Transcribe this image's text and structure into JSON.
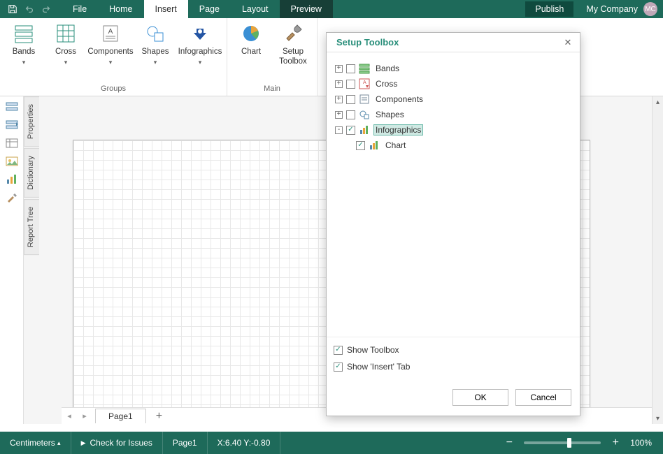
{
  "topbar": {
    "menus": [
      "File",
      "Home",
      "Insert",
      "Page",
      "Layout",
      "Preview"
    ],
    "active_menu": "Insert",
    "publish": "Publish",
    "company": "My Company",
    "avatar": "MC"
  },
  "ribbon": {
    "groups": [
      {
        "label": "Groups",
        "items": [
          {
            "key": "bands",
            "label": "Bands",
            "dropdown": true
          },
          {
            "key": "cross",
            "label": "Cross",
            "dropdown": true
          },
          {
            "key": "components",
            "label": "Components",
            "dropdown": true
          },
          {
            "key": "shapes",
            "label": "Shapes",
            "dropdown": true
          },
          {
            "key": "infographics",
            "label": "Infographics",
            "dropdown": true
          }
        ]
      },
      {
        "label": "Main",
        "items": [
          {
            "key": "chart",
            "label": "Chart",
            "dropdown": false
          },
          {
            "key": "setup-toolbox",
            "label": "Setup\nToolbox",
            "dropdown": false
          }
        ]
      }
    ]
  },
  "side_tabs": [
    "Properties",
    "Dictionary",
    "Report Tree"
  ],
  "page_tabs": {
    "page": "Page1"
  },
  "dialog": {
    "title": "Setup Toolbox",
    "tree": [
      {
        "exp": "+",
        "checked": false,
        "icon": "bands",
        "label": "Bands"
      },
      {
        "exp": "+",
        "checked": false,
        "icon": "cross",
        "label": "Cross"
      },
      {
        "exp": "+",
        "checked": false,
        "icon": "components",
        "label": "Components"
      },
      {
        "exp": "+",
        "checked": false,
        "icon": "shapes",
        "label": "Shapes"
      },
      {
        "exp": "-",
        "checked": true,
        "icon": "infographics",
        "label": "Infographics",
        "selected": true
      },
      {
        "indent": true,
        "checked": true,
        "icon": "chart",
        "label": "Chart"
      }
    ],
    "opt1": "Show Toolbox",
    "opt2": "Show 'Insert' Tab",
    "ok": "OK",
    "cancel": "Cancel"
  },
  "status": {
    "units": "Centimeters",
    "check": "Check for Issues",
    "page": "Page1",
    "coords": "X:6.40 Y:-0.80",
    "zoom": "100%"
  }
}
